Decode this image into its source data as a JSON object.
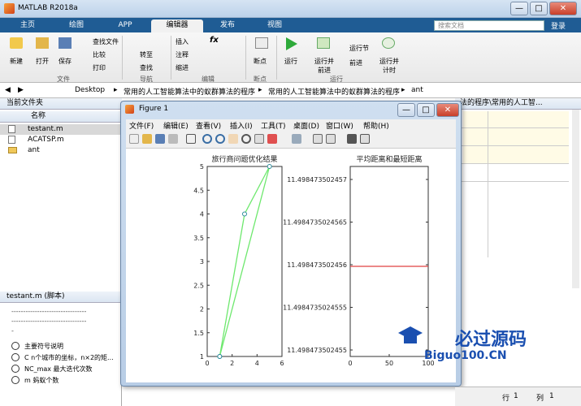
{
  "window": {
    "title": "MATLAB R2018a",
    "min": "—",
    "max": "□",
    "close": "✕"
  },
  "tabs": [
    {
      "label": "主页"
    },
    {
      "label": "绘图"
    },
    {
      "label": "APP"
    },
    {
      "label": "编辑器"
    },
    {
      "label": "发布"
    },
    {
      "label": "视图"
    }
  ],
  "search_placeholder": "搜索文档",
  "login": "登录",
  "ribbon": {
    "new": "新建",
    "open": "打开",
    "save": "保存",
    "find_files": "查找文件",
    "compare": "比较",
    "print": "打印",
    "goto": "转至",
    "find": "查找",
    "insert": "插入",
    "comment": "注释",
    "indent": "缩进",
    "fx": "fx",
    "breakpoint": "断点",
    "run": "运行",
    "run_advance": "运行并前进",
    "run_section": "运行节",
    "advance": "前进",
    "run_time": "运行并计时",
    "groups": {
      "file": "文件",
      "nav": "导航",
      "edit": "编辑",
      "bp": "断点",
      "run": "运行"
    }
  },
  "address": {
    "path": [
      "Desktop",
      "常用的人工智能算法中的蚁群算法的程序",
      "常用的人工智能算法中的蚁群算法的程序",
      "ant"
    ],
    "right_path": "法的程序\\常用的人工智..."
  },
  "left": {
    "header": "当前文件夹",
    "col_name": "名称",
    "files": [
      {
        "name": "testant.m"
      },
      {
        "name": "ACATSP.m"
      },
      {
        "name": "ant"
      }
    ],
    "details_title": "testant.m  (脚本)",
    "dash1": "--------------------------------",
    "dash2": "--------------------------------",
    "dash3": "-",
    "comments": [
      "主要符号说明",
      "C n个城市的坐标，n×2的矩...",
      "NC_max 最大迭代次数",
      "m 蚂蚁个数"
    ]
  },
  "figure": {
    "title": "Figure 1",
    "menus": [
      "文件(F)",
      "编辑(E)",
      "查看(V)",
      "插入(I)",
      "工具(T)",
      "桌面(D)",
      "窗口(W)",
      "帮助(H)"
    ]
  },
  "status": {
    "row_label": "行",
    "row": "1",
    "col_label": "列",
    "col": "1"
  },
  "watermark": {
    "text": "必过源码",
    "url": "Biguo100.CN"
  },
  "chart_data": [
    {
      "type": "line",
      "title": "旅行商问题优化结果",
      "xlim": [
        0,
        6
      ],
      "ylim": [
        1,
        5
      ],
      "xticks": [
        0,
        2,
        4,
        6
      ],
      "yticks": [
        1,
        1.5,
        2,
        2.5,
        3,
        3.5,
        4,
        4.5,
        5
      ],
      "series": [
        {
          "x": [
            1,
            3,
            5,
            1
          ],
          "y": [
            1,
            4,
            5,
            1
          ],
          "color": "#6ee86e"
        }
      ]
    },
    {
      "type": "line",
      "title": "平均距离和最短距离",
      "xlim": [
        0,
        100
      ],
      "xticks": [
        0,
        50,
        100
      ],
      "yticks": [
        "11.498473502457",
        "11.4984735024565",
        "11.498473502456",
        "11.4984735024555",
        "11.498473502455"
      ],
      "series": [
        {
          "x": [
            0,
            100
          ],
          "y": [
            11.498473502456,
            11.498473502456
          ],
          "color": "#e04040"
        }
      ]
    }
  ]
}
